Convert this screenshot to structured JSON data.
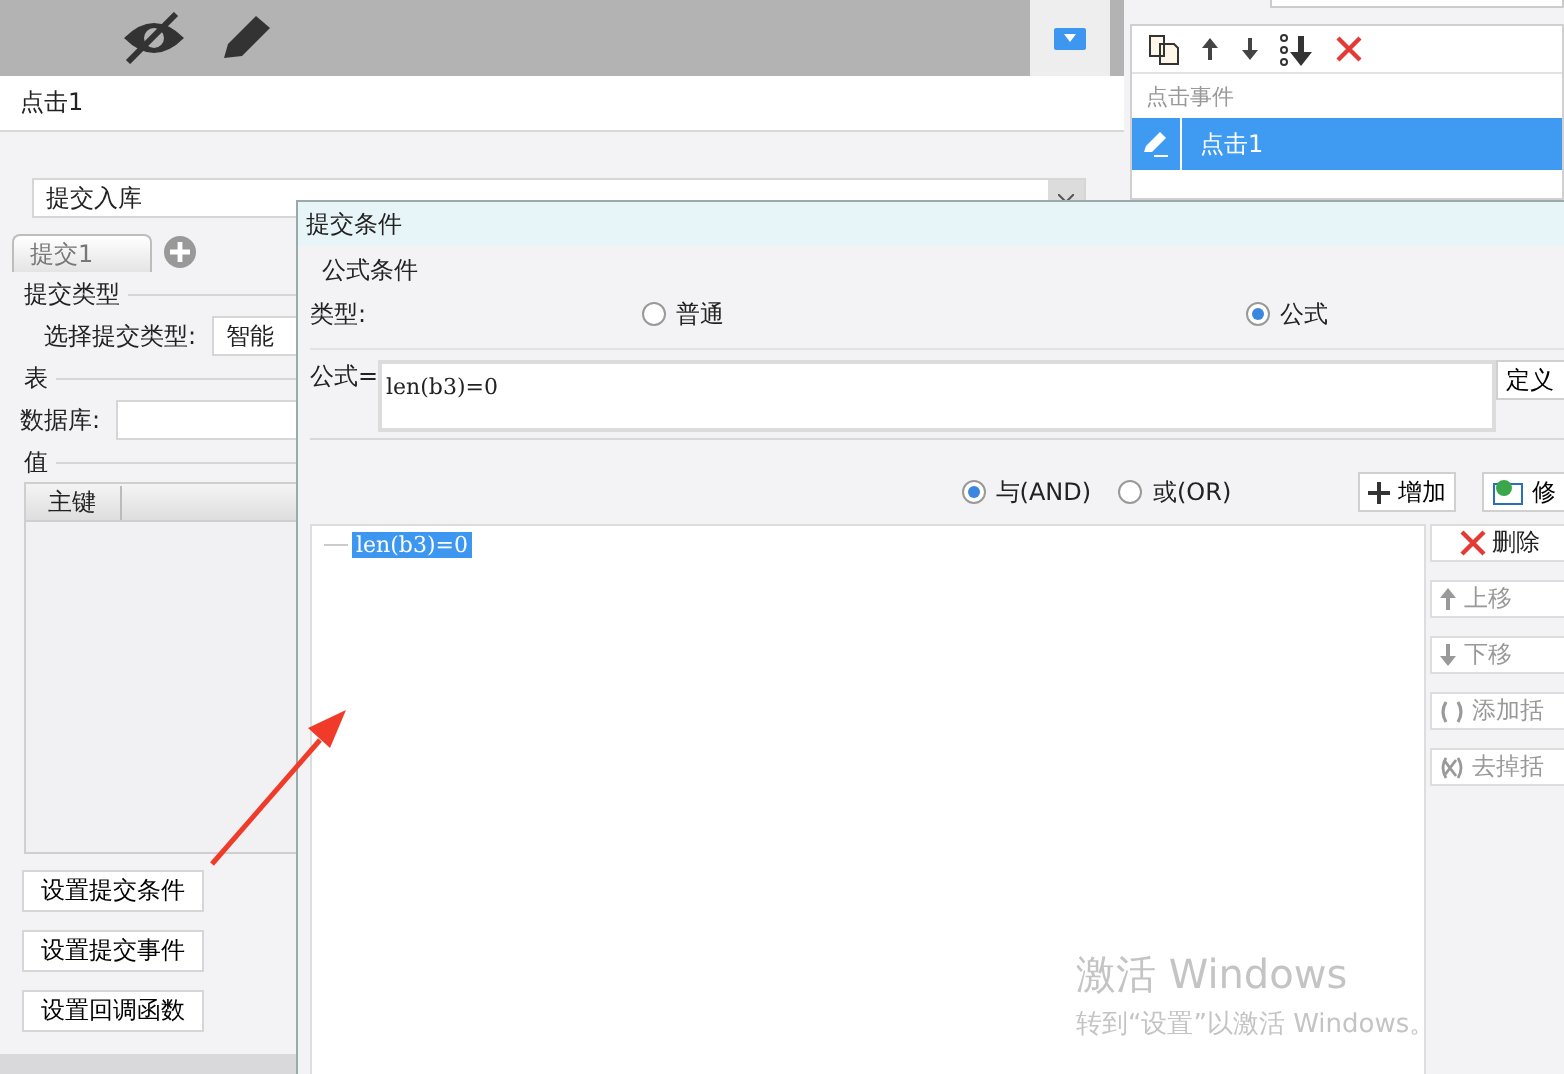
{
  "header_title": "点击1",
  "event_panel": {
    "header": "点击事件",
    "items": [
      {
        "label": "点击1",
        "selected": true
      }
    ]
  },
  "submit_select": {
    "value": "提交入库"
  },
  "tabs": [
    {
      "label": "提交1",
      "selected": true
    }
  ],
  "submit_type": {
    "legend": "提交类型",
    "label": "选择提交类型:",
    "value": "智能"
  },
  "table_section": {
    "legend": "表",
    "db_label": "数据库:"
  },
  "values": {
    "legend": "值",
    "columns": [
      "主键"
    ]
  },
  "buttons": [
    "设置提交条件",
    "设置提交事件",
    "设置回调函数"
  ],
  "dialog": {
    "title": "提交条件",
    "legend": "公式条件",
    "type_label": "类型:",
    "type_options": [
      {
        "label": "普通",
        "selected": false
      },
      {
        "label": "公式",
        "selected": true
      }
    ],
    "formula_label": "公式=",
    "formula": "len(b3)=0",
    "define_button": "定义",
    "logic_options": [
      {
        "label": "与(AND)",
        "selected": true
      },
      {
        "label": "或(OR)",
        "selected": false
      }
    ],
    "add_button": "增加",
    "edit_button": "修",
    "conditions": [
      {
        "text": "len(b3)=0",
        "selected": true
      }
    ],
    "side_buttons": [
      {
        "kind": "delete",
        "label": "删除",
        "disabled": false
      },
      {
        "kind": "up",
        "label": "上移",
        "disabled": true
      },
      {
        "kind": "down",
        "label": "下移",
        "disabled": true
      },
      {
        "kind": "add-bracket",
        "label": "添加括",
        "disabled": true
      },
      {
        "kind": "remove-bracket",
        "label": "去掉括",
        "disabled": true
      }
    ]
  },
  "os_watermark": {
    "title": "激活 Windows",
    "subtitle": "转到“设置”以激活 Windows。"
  }
}
